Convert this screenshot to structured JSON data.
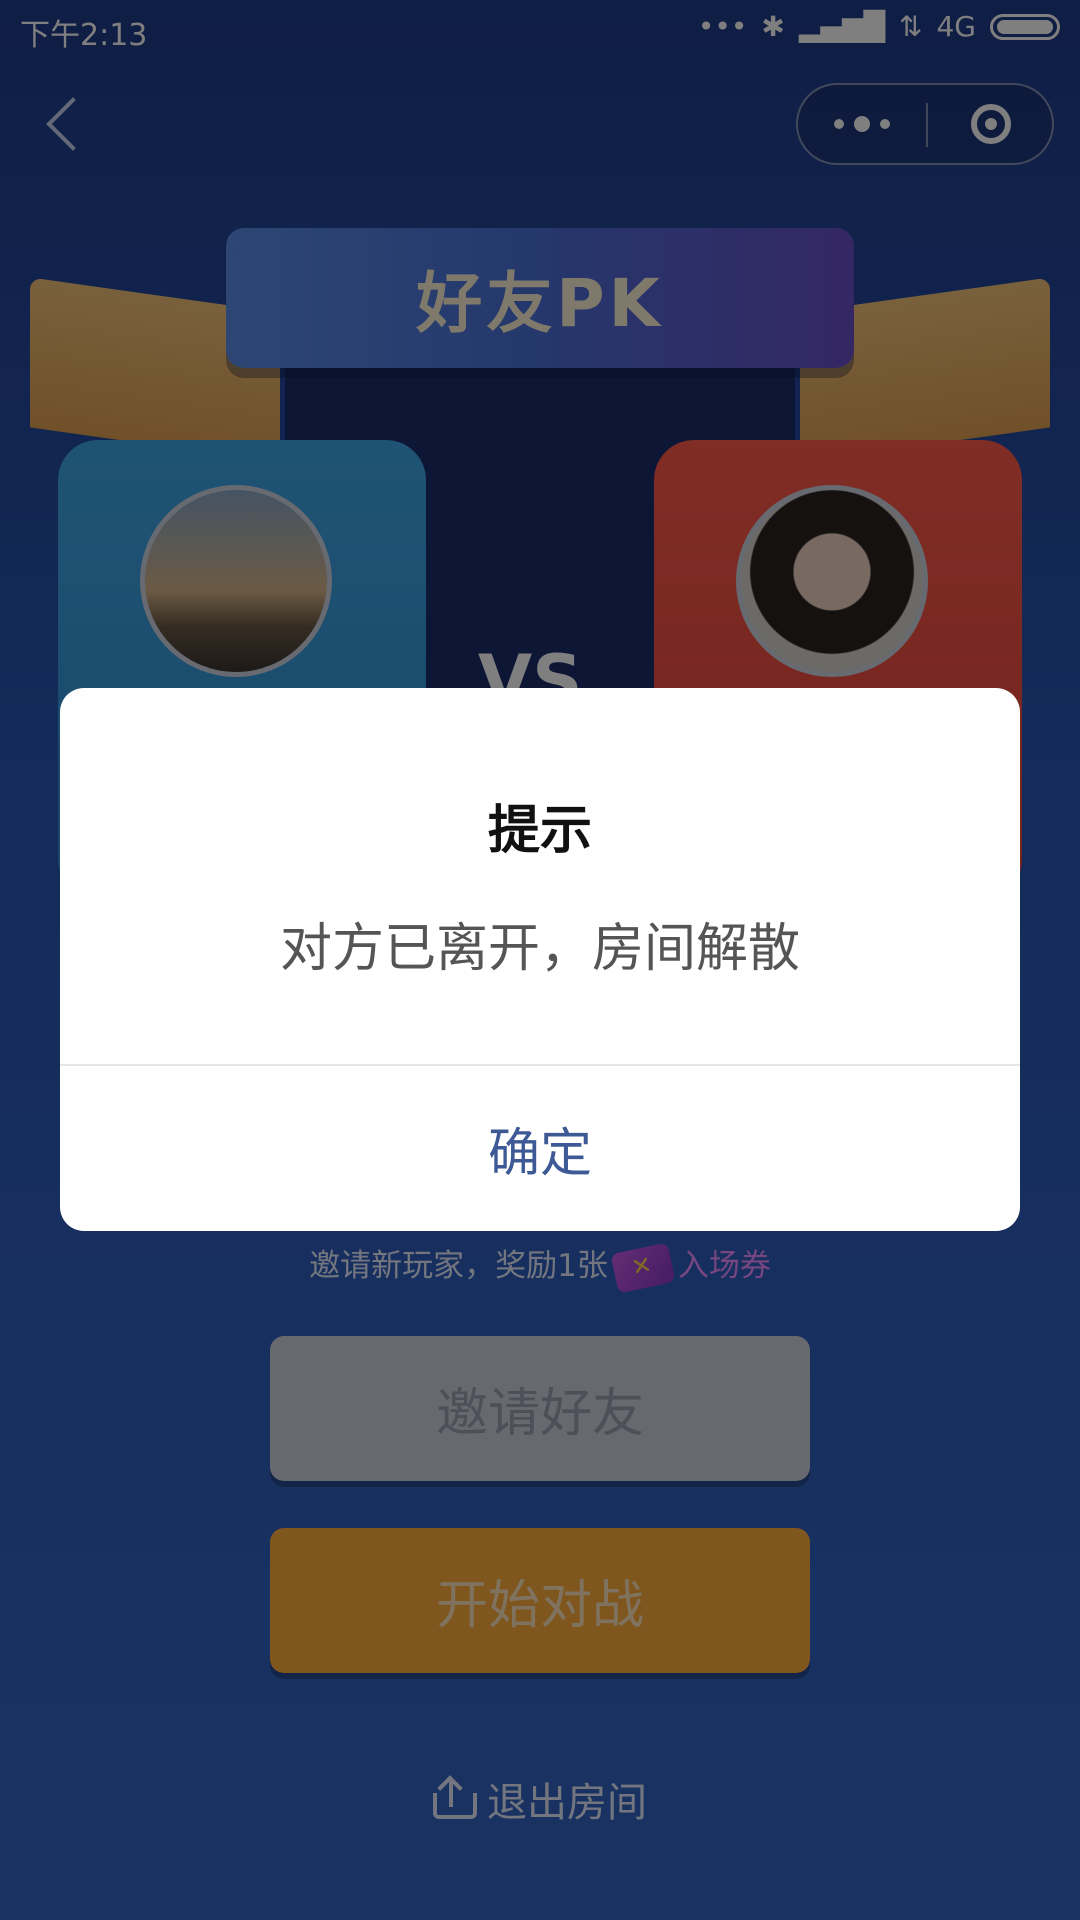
{
  "status_bar": {
    "time": "下午2:13",
    "network": "4G",
    "icons": [
      "more-dots-icon",
      "bluetooth-icon",
      "signal-icon",
      "data-arrows-icon",
      "battery-icon"
    ]
  },
  "nav": {
    "back_icon": "back-chevron-icon",
    "more_icon": "more-dots-icon",
    "close_icon": "target-close-icon"
  },
  "header": {
    "title": "好友PK"
  },
  "players": {
    "left_avatar": "lighthouse-avatar",
    "right_avatar": "girl-avatar",
    "vs": "VS"
  },
  "dialog": {
    "title": "提示",
    "message": "对方已离开，房间解散",
    "confirm": "确定"
  },
  "invite": {
    "tip_prefix": "邀请新玩家，奖励1张",
    "ticket_label": "入场券",
    "ticket_icon": "ticket-icon"
  },
  "buttons": {
    "invite": "邀请好友",
    "start": "开始对战",
    "exit": "退出房间",
    "exit_icon": "exit-upload-icon"
  },
  "colors": {
    "background": "#2a56b3",
    "confirm_text": "#3d5a96",
    "start_button": "#ffad3b",
    "left_card": "#3fa7e8",
    "right_card": "#ff5a4a"
  }
}
